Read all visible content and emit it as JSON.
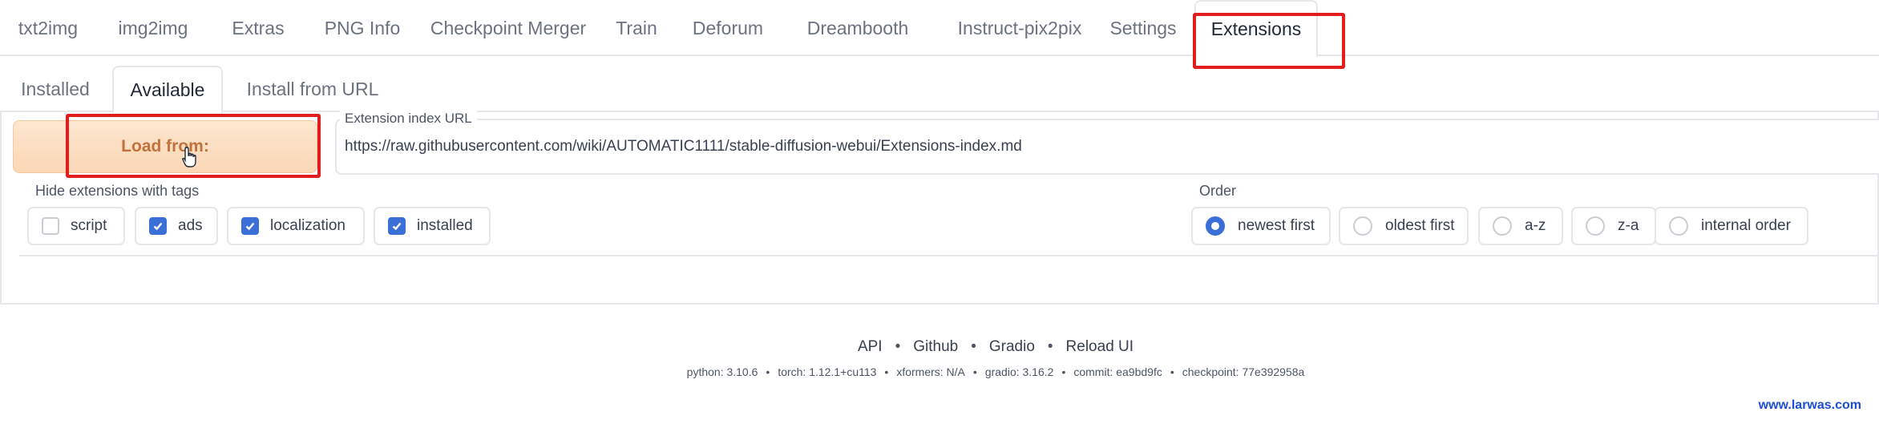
{
  "top_tabs": [
    {
      "label": "txt2img"
    },
    {
      "label": "img2img"
    },
    {
      "label": "Extras"
    },
    {
      "label": "PNG Info"
    },
    {
      "label": "Checkpoint Merger"
    },
    {
      "label": "Train"
    },
    {
      "label": "Deforum"
    },
    {
      "label": "Dreambooth"
    },
    {
      "label": "Instruct-pix2pix"
    },
    {
      "label": "Settings"
    },
    {
      "label": "Extensions",
      "active": true
    }
  ],
  "sub_tabs": [
    {
      "label": "Installed"
    },
    {
      "label": "Available",
      "active": true
    },
    {
      "label": "Install from URL"
    }
  ],
  "load_button": {
    "label": "Load from:"
  },
  "extension_index": {
    "label": "Extension index URL",
    "value": "https://raw.githubusercontent.com/wiki/AUTOMATIC1111/stable-diffusion-webui/Extensions-index.md"
  },
  "hide_tags": {
    "label": "Hide extensions with tags",
    "options": [
      {
        "label": "script",
        "checked": false
      },
      {
        "label": "ads",
        "checked": true
      },
      {
        "label": "localization",
        "checked": true
      },
      {
        "label": "installed",
        "checked": true
      }
    ]
  },
  "order": {
    "label": "Order",
    "options": [
      {
        "label": "newest first",
        "selected": true
      },
      {
        "label": "oldest first",
        "selected": false
      },
      {
        "label": "a-z",
        "selected": false
      },
      {
        "label": "z-a",
        "selected": false
      },
      {
        "label": "internal order",
        "selected": false
      }
    ]
  },
  "footer": {
    "links": [
      "API",
      "Github",
      "Gradio",
      "Reload UI"
    ],
    "separator": "•",
    "versions": [
      "python: 3.10.6",
      "torch: 1.12.1+cu113",
      "xformers: N/A",
      "gradio: 3.16.2",
      "commit: ea9bd9fc",
      "checkpoint: 77e392958a"
    ]
  },
  "watermark": "www.larwas.com",
  "colors": {
    "accent_blue": "#3b6fd8",
    "load_button_bg": "#fbd7b6",
    "load_button_text": "#c2713a",
    "highlight_red": "#e11d1d"
  }
}
